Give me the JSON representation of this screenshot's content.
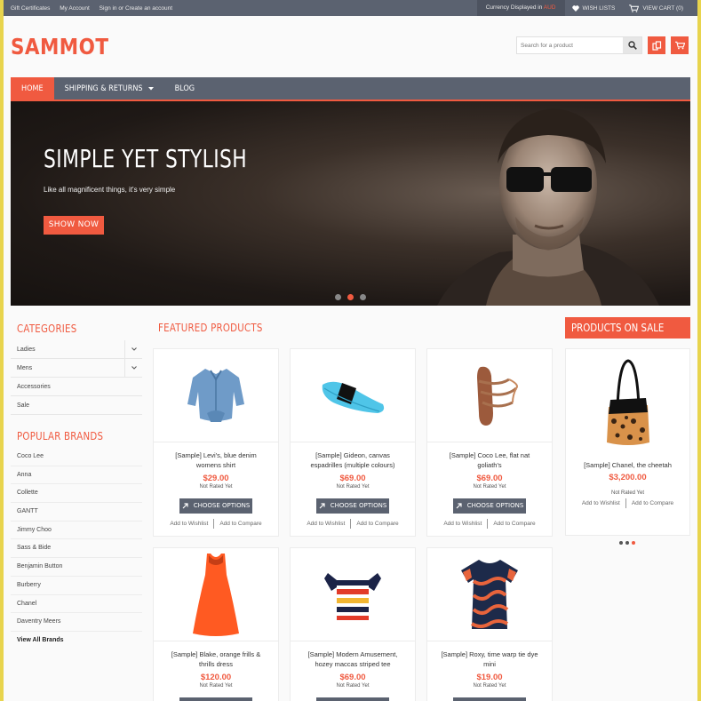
{
  "topbar": {
    "gift": "Gift Certificates",
    "account": "My Account",
    "signin": "Sign in",
    "or": "or",
    "create": "Create an account",
    "currency_label": "Currency Displayed in",
    "currency_value": "AUD",
    "wishlist": "WISH LISTS",
    "cart": "VIEW CART (0)"
  },
  "header": {
    "logo": "SAMMOT",
    "search_placeholder": "Search for a product"
  },
  "nav": {
    "items": [
      {
        "label": "HOME",
        "active": true
      },
      {
        "label": "SHIPPING & RETURNS",
        "dropdown": true
      },
      {
        "label": "BLOG"
      }
    ]
  },
  "hero": {
    "title": "SIMPLE YET STYLISH",
    "subtitle": "Like all magnificent things, it's very simple",
    "button": "SHOW NOW",
    "active_slide": 2,
    "slides": 3
  },
  "categories": {
    "heading": "CATEGORIES",
    "items": [
      "Ladies",
      "Mens",
      "Accessories",
      "Sale"
    ]
  },
  "brands": {
    "heading": "POPULAR BRANDS",
    "items": [
      "Coco Lee",
      "Anna",
      "Collette",
      "GANTT",
      "Jimmy Choo",
      "Sass & Bide",
      "Benjamin Button",
      "Burberry",
      "Chanel",
      "Daventry Meers"
    ],
    "view_all": "View All Brands"
  },
  "featured": {
    "heading": "FEATURED PRODUCTS",
    "option_label": "CHOOSE OPTIONS",
    "wishlist_label": "Add to Wishlist",
    "compare_label": "Add to Compare",
    "rated_label": "Not Rated Yet",
    "products": [
      {
        "name": "[Sample] Levi's, blue denim womens shirt",
        "price": "$29.00",
        "image": "denim-shirt"
      },
      {
        "name": "[Sample] Gideon, canvas espadrilles (multiple colours)",
        "price": "$69.00",
        "image": "espadrille"
      },
      {
        "name": "[Sample] Coco Lee, flat nat goliath's",
        "price": "$69.00",
        "image": "sandal"
      },
      {
        "name": "[Sample] Blake, orange frills & thrills dress",
        "price": "$120.00",
        "image": "orange-dress"
      },
      {
        "name": "[Sample] Modern Amusement, hozey maccas striped tee",
        "price": "$69.00",
        "image": "striped-tee"
      },
      {
        "name": "[Sample] Roxy, time warp tie dye mini",
        "price": "$19.00",
        "image": "tie-dye-dress"
      }
    ]
  },
  "sale": {
    "heading": "PRODUCTS ON SALE",
    "product": {
      "name": "[Sample] Chanel, the cheetah",
      "price": "$3,200.00",
      "rated": "Not Rated Yet",
      "image": "cheetah-bag"
    },
    "wishlist_label": "Add to Wishlist",
    "compare_label": "Add to Compare"
  },
  "colors": {
    "accent": "#f05a40",
    "nav": "#5b6270"
  }
}
